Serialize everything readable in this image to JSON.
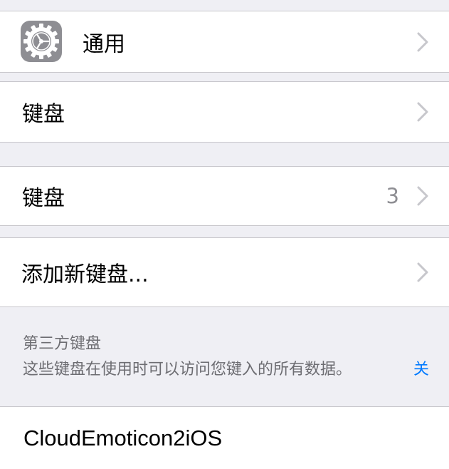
{
  "general_row": {
    "label": "通用",
    "icon": "gear-icon"
  },
  "keyboard_nav_row": {
    "label": "键盘"
  },
  "keyboards_row": {
    "label": "键盘",
    "count": "3"
  },
  "add_keyboard_row": {
    "label": "添加新键盘..."
  },
  "third_party_section": {
    "header": "第三方键盘",
    "footer": "这些键盘在使用时可以访问您键入的所有数据。",
    "link": "关"
  },
  "third_party_keyboard": {
    "label": "CloudEmoticon2iOS"
  },
  "colors": {
    "background": "#efeff4",
    "separator": "#c8c7cc",
    "secondary_text": "#8e8e93",
    "section_text": "#6d6d72",
    "link": "#007aff",
    "icon_bg": "#8e8e93"
  }
}
